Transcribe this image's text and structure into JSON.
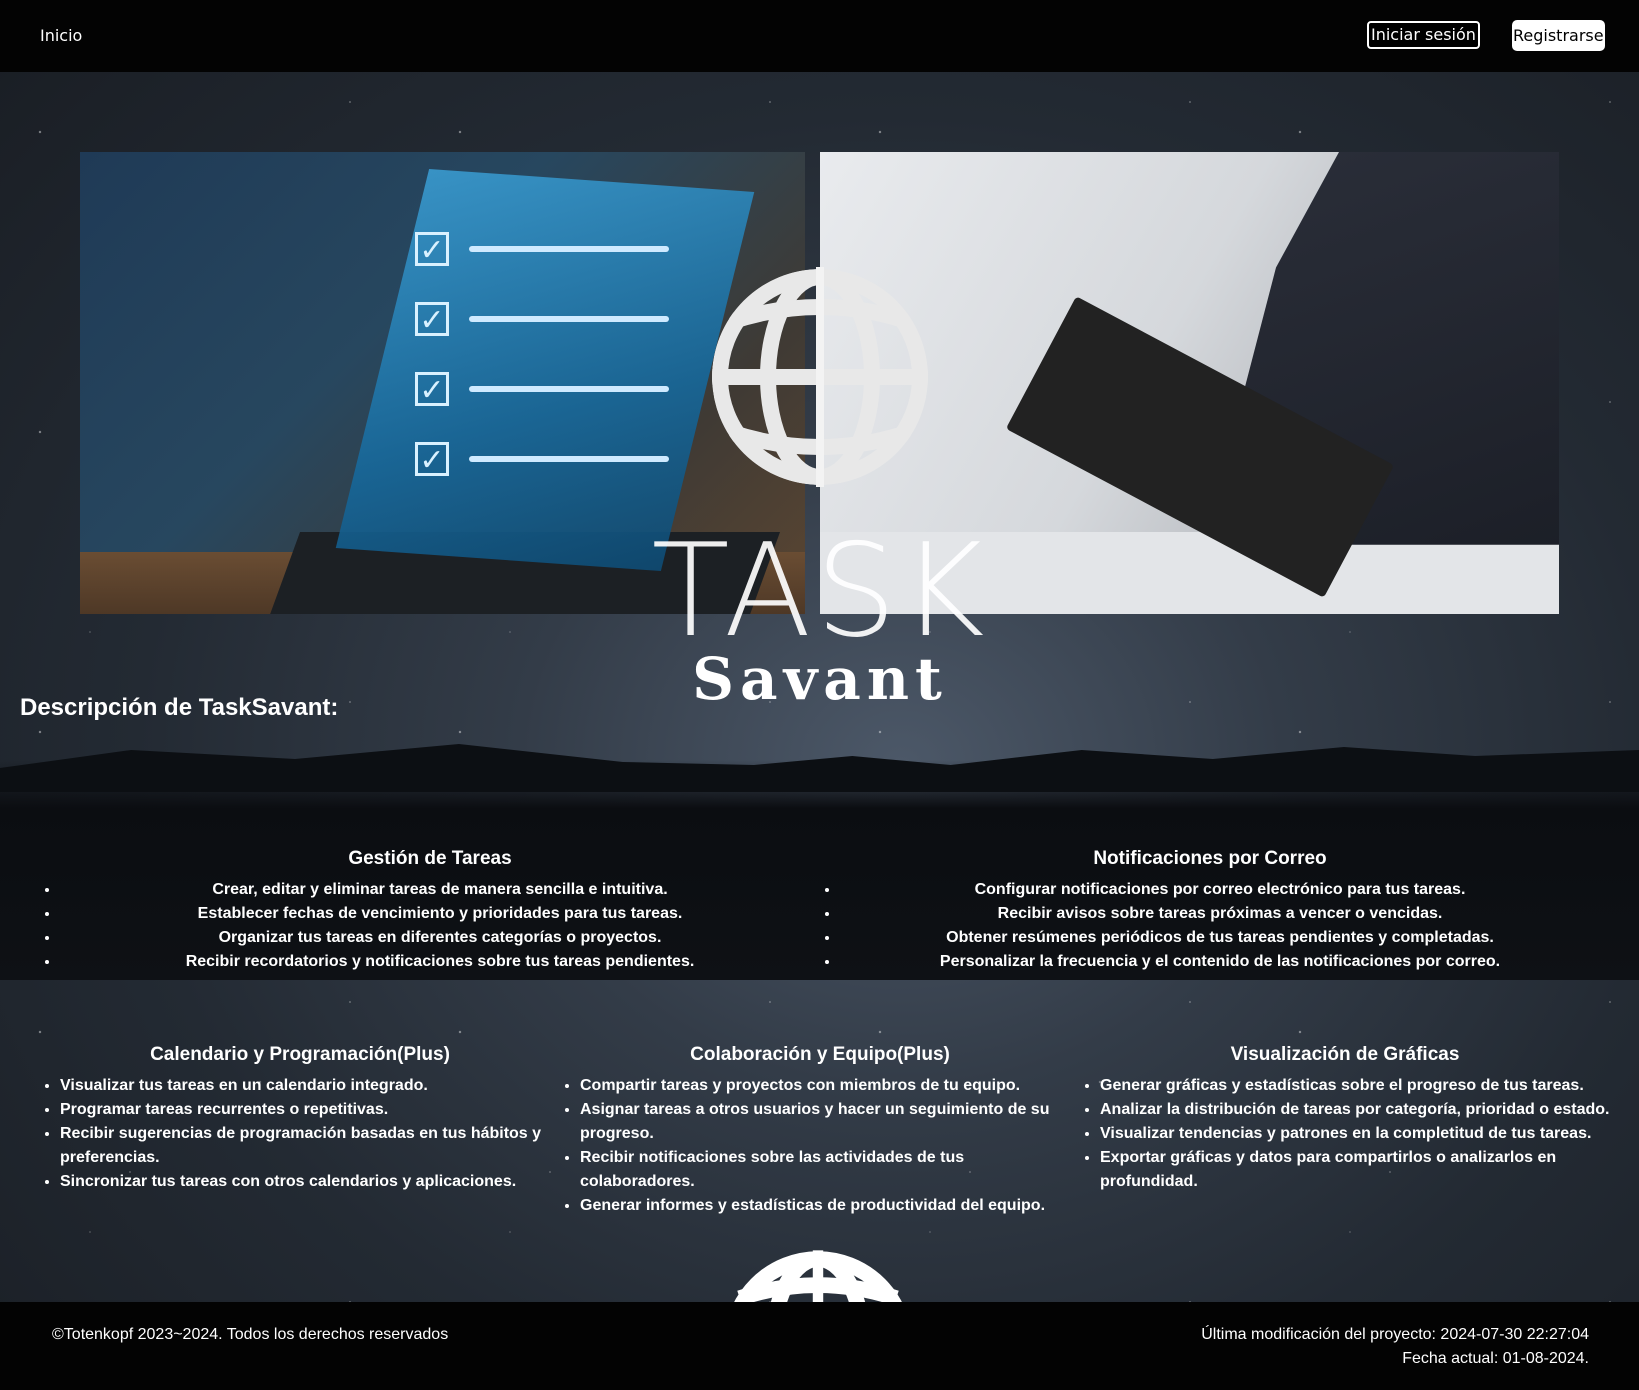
{
  "header": {
    "home_link": "Inicio",
    "login_button": "Iniciar sesión",
    "register_button": "Registrarse"
  },
  "logo": {
    "line1": "TASK",
    "line2": "Savant"
  },
  "description_title": "Descripción de TaskSavant:",
  "features": [
    {
      "title": "Gestión de Tareas",
      "items": [
        "Crear, editar y eliminar tareas de manera sencilla e intuitiva.",
        "Establecer fechas de vencimiento y prioridades para tus tareas.",
        "Organizar tus tareas en diferentes categorías o proyectos.",
        "Recibir recordatorios y notificaciones sobre tus tareas pendientes."
      ]
    },
    {
      "title": "Notificaciones por Correo",
      "items": [
        "Configurar notificaciones por correo electrónico para tus tareas.",
        "Recibir avisos sobre tareas próximas a vencer o vencidas.",
        "Obtener resúmenes periódicos de tus tareas pendientes y completadas.",
        "Personalizar la frecuencia y el contenido de las notificaciones por correo."
      ]
    },
    {
      "title": "Calendario y Programación(Plus)",
      "items": [
        "Visualizar tus tareas en un calendario integrado.",
        "Programar tareas recurrentes o repetitivas.",
        "Recibir sugerencias de programación basadas en tus hábitos y preferencias.",
        "Sincronizar tus tareas con otros calendarios y aplicaciones."
      ]
    },
    {
      "title": "Colaboración y Equipo(Plus)",
      "items": [
        "Compartir tareas y proyectos con miembros de tu equipo.",
        "Asignar tareas a otros usuarios y hacer un seguimiento de su progreso.",
        "Recibir notificaciones sobre las actividades de tus colaboradores.",
        "Generar informes y estadísticas de productividad del equipo."
      ]
    },
    {
      "title": "Visualización de Gráficas",
      "items": [
        "Generar gráficas y estadísticas sobre el progreso de tus tareas.",
        "Analizar la distribución de tareas por categoría, prioridad o estado.",
        "Visualizar tendencias y patrones en la completitud de tus tareas.",
        "Exportar gráficas y datos para compartirlos o analizarlos en profundidad."
      ]
    }
  ],
  "footer": {
    "copyright": "©Totenkopf 2023~2024. Todos los derechos reservados",
    "last_modified": "Última modificación del proyecto: 2024-07-30 22:27:04",
    "current_date": "Fecha actual: 01-08-2024."
  },
  "icons": {
    "globe": "globe-icon",
    "checkbox": "check-icon"
  }
}
